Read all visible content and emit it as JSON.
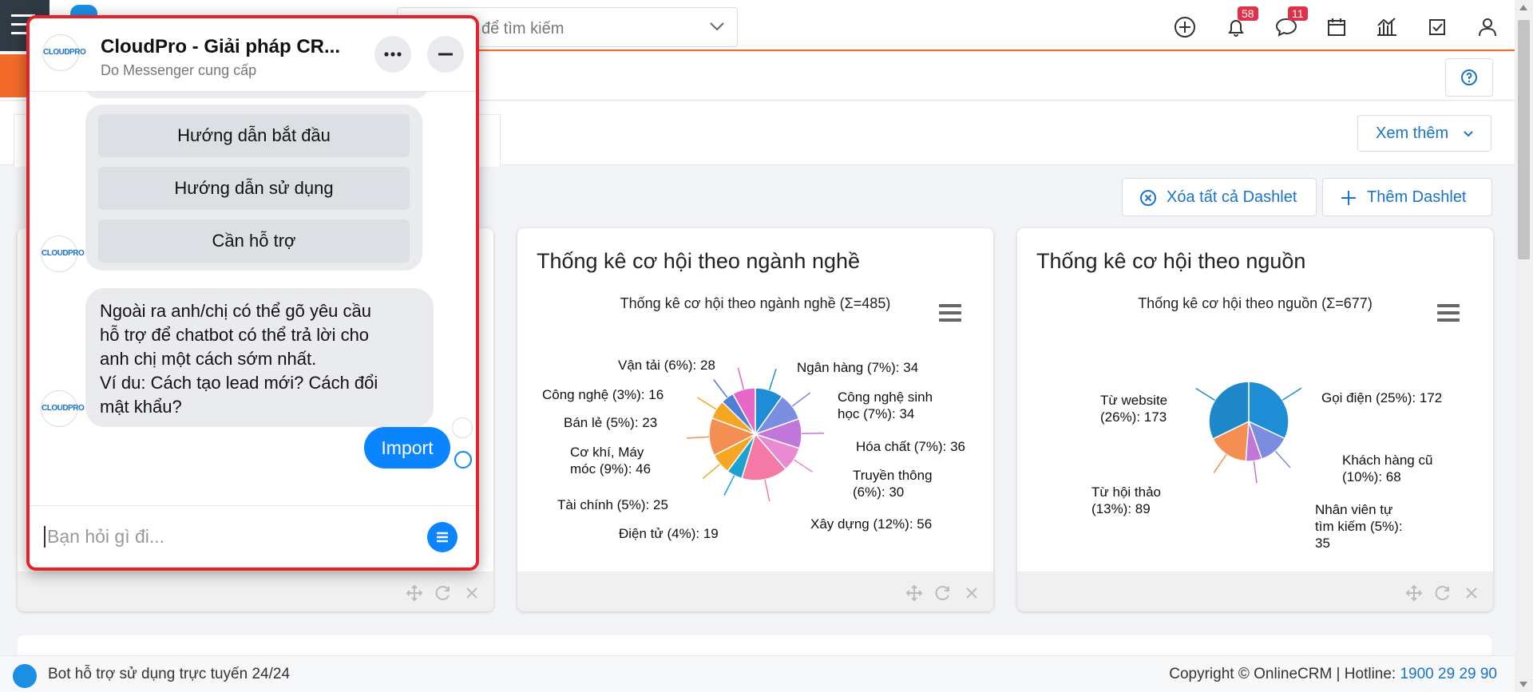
{
  "header": {
    "search_placeholder": "để tìm kiếm",
    "notification_count": "58",
    "message_count": "11"
  },
  "toolbar": {
    "xem_them": "Xem thêm",
    "clear_all": "Xóa tất cả Dashlet",
    "add_dashlet": "Thêm Dashlet"
  },
  "dashlets": [
    {
      "title": "Thống kê cơ hội theo ngành nghề",
      "chart_title": "Thống kê cơ hội theo ngành nghề (Σ=485)",
      "labels": {
        "van_tai": "Vận tải (6%): 28",
        "cong_nghe": "Công nghệ (3%): 16",
        "ban_le": "Bán lẻ (5%): 23",
        "co_khi_1": "Cơ khí, Máy",
        "co_khi_2": "móc (9%): 46",
        "tai_chinh": "Tài chính (5%): 25",
        "dien_tu": "Điện tử (4%): 19",
        "ngan_hang": "Ngân hàng (7%): 34",
        "cnsh_1": "Công nghệ sinh",
        "cnsh_2": "học (7%): 34",
        "hoa_chat": "Hóa chất (7%): 36",
        "truyen_thong_1": "Truyền thông",
        "truyen_thong_2": "(6%): 30",
        "xay_dung": "Xây dựng (12%): 56"
      }
    },
    {
      "title": "Thống kê cơ hội theo nguồn",
      "chart_title": "Thống kê cơ hội theo nguồn (Σ=677)",
      "labels": {
        "tu_website_1": "Từ website",
        "tu_website_2": "(26%): 173",
        "goi_dien": "Gọi điện (25%): 172",
        "khach_hang_cu_1": "Khách hàng cũ",
        "khach_hang_cu_2": "(10%): 68",
        "tu_hoi_thao_1": "Từ hội thảo",
        "tu_hoi_thao_2": "(13%): 89",
        "nhan_vien_1": "Nhân viên tự",
        "nhan_vien_2": "tìm kiếm (5%):",
        "nhan_vien_3": "35"
      }
    }
  ],
  "chart_data": [
    {
      "type": "pie",
      "title": "Thống kê cơ hội theo ngành nghề (Σ=485)",
      "categories": [
        "Ngân hàng",
        "Công nghệ sinh học",
        "Hóa chất",
        "Truyền thông",
        "Xây dựng",
        "Điện tử",
        "Tài chính",
        "Cơ khí, Máy móc",
        "Bán lẻ",
        "Công nghệ",
        "Vận tải"
      ],
      "values": [
        34,
        34,
        36,
        30,
        56,
        19,
        25,
        46,
        23,
        16,
        28
      ],
      "colors": [
        "#1f8dd6",
        "#7b8de0",
        "#c077d9",
        "#e88bd1",
        "#f47aa5",
        "#1ea0d0",
        "#f5a623",
        "#f58e52",
        "#f5a623",
        "#4f7fd4",
        "#e866c7"
      ]
    },
    {
      "type": "pie",
      "title": "Thống kê cơ hội theo nguồn (Σ=677)",
      "categories": [
        "Gọi điện",
        "Khách hàng cũ",
        "Nhân viên tự tìm kiếm",
        "Từ hội thảo",
        "Từ website"
      ],
      "values": [
        172,
        68,
        35,
        89,
        173
      ],
      "colors": [
        "#1f8dd6",
        "#7b8de0",
        "#c077d9",
        "#f58e52",
        "#1e88c8"
      ]
    }
  ],
  "chat": {
    "name": "CloudPro - Giải pháp CR...",
    "sub": "Do Messenger cung cấp",
    "logo_text": "CLOUDPRO",
    "quick_replies": [
      "Hướng dẫn bắt đầu",
      "Hướng dẫn sử dụng",
      "Cần hỗ trợ"
    ],
    "message": "Ngoài ra anh/chị có thể gõ yêu cầu\nhỗ trợ để chatbot có thể trả lời cho\nanh chị một cách sớm nhất.\nVí du: Cách tạo lead mới? Cách đổi\nmật khẩu?",
    "import_label": "Import",
    "input_placeholder": "Bạn hỏi gì đi..."
  },
  "footer": {
    "bot_label": "Bot hỗ trợ sử dụng trực tuyến 24/24",
    "copyright": "Copyright © OnlineCRM | Hotline: ",
    "hotline": "1900 29 29 90"
  }
}
